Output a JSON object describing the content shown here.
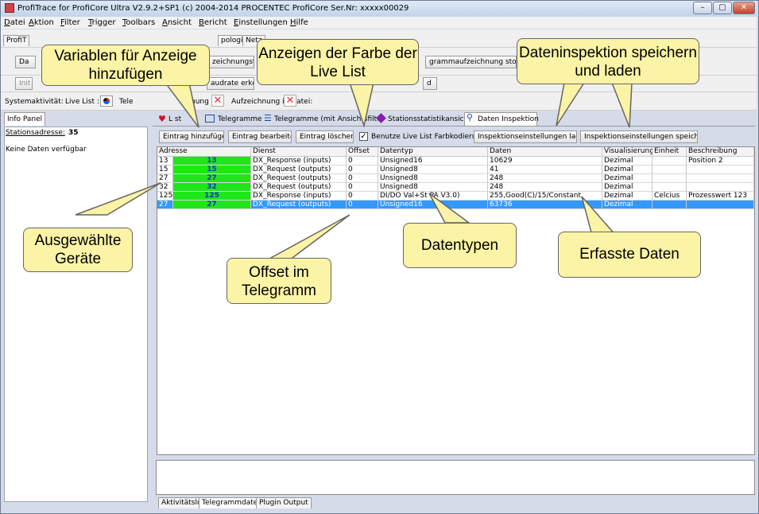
{
  "window": {
    "title": "ProfiTrace for ProfiCore Ultra V2.9.2+SP1 (c) 2004-2014 PROCENTEC  ProfiCore Ser.Nr: xxxxx00029",
    "controls": {
      "minimize": "–",
      "maximize": "▢",
      "close": "✕"
    }
  },
  "menu": [
    "Datei",
    "Aktion",
    "Filter",
    "Trigger",
    "Toolbars",
    "Ansicht",
    "Bericht",
    "Einstellungen",
    "Hilfe"
  ],
  "toolbar": {
    "tabs_partial": [
      "ProfiT",
      "pologie",
      "Netz"
    ],
    "row2_buttons": [
      "Da",
      "zeichnungstrig",
      "grammaufzeichnung stoppen"
    ],
    "row3_buttons": [
      "Init",
      "audrate erkenn",
      "d"
    ]
  },
  "status": {
    "system_label": "Systemaktivität:",
    "livelist_label": "Live List :",
    "tele_label": "Tele",
    "nung_label": "nung :",
    "recording_label": "Aufzeichnung in Datei:"
  },
  "info_panel": {
    "tab": "Info Panel",
    "station_label": "Stationsadresse:",
    "station_value": "35",
    "no_data": "Keine Daten verfügbar"
  },
  "main_tabs": [
    {
      "label": "L  st",
      "icon": "heart-icon"
    },
    {
      "label": "Telegramme",
      "icon": "telegram-icon"
    },
    {
      "label": "Telegramme (mit Ansichtsfilte",
      "icon": "filter-icon"
    },
    {
      "label": "Stationsstatistikansicht",
      "icon": "statistics-icon"
    },
    {
      "label": "Daten Inspektion",
      "icon": "magnifier-icon",
      "active": true
    }
  ],
  "actions": {
    "add": "Eintrag hinzufügen",
    "edit": "Eintrag bearbeiten",
    "delete": "Eintrag löschen",
    "use_colors": "Benutze Live List Farbkodierung",
    "load": "Inspektionseinstellungen laden",
    "save": "Inspektionseinstellungen speichern"
  },
  "table": {
    "headers": [
      "Adresse",
      "Dienst",
      "Offset",
      "Datentyp",
      "Daten",
      "Visualisierung",
      "Einheit",
      "Beschreibung"
    ],
    "rows": [
      {
        "addr": "13",
        "color": "13",
        "service": "DX_Response (inputs)",
        "offset": "0",
        "type": "Unsigned16",
        "data": "10629",
        "vis": "Dezimal",
        "unit": "",
        "desc": "Position 2"
      },
      {
        "addr": "15",
        "color": "15",
        "service": "DX_Request (outputs)",
        "offset": "0",
        "type": "Unsigned8",
        "data": "41",
        "vis": "Dezimal",
        "unit": "",
        "desc": ""
      },
      {
        "addr": "27",
        "color": "27",
        "service": "DX_Request (outputs)",
        "offset": "0",
        "type": "Unsigned8",
        "data": "248",
        "vis": "Dezimal",
        "unit": "",
        "desc": ""
      },
      {
        "addr": "32",
        "color": "32",
        "service": "DX_Request (outputs)",
        "offset": "0",
        "type": "Unsigned8",
        "data": "248",
        "vis": "Dezimal",
        "unit": "",
        "desc": ""
      },
      {
        "addr": "125",
        "color": "125",
        "service": "DX_Response (inputs)",
        "offset": "0",
        "type": "DI/DO Val+St      PA V3.0)",
        "data": "255,Good(C)/15/Constant",
        "vis": "Dezimal",
        "unit": "Celcius",
        "desc": "Prozesswert 123"
      },
      {
        "addr": "27",
        "color": "27",
        "service": "DX_Request (outputs)",
        "offset": "0",
        "type": "Unsigned16",
        "data": "63736",
        "vis": "Dezimal",
        "unit": "",
        "desc": "",
        "selected": true
      }
    ]
  },
  "bottom_tabs": [
    "Aktivitätslog",
    "Telegrammdaten",
    "Plugin Output"
  ],
  "callouts": {
    "variablen": "Variablen für Anzeige hinzufügen",
    "farbe": "Anzeigen der Farbe der Live List",
    "inspektion": "Dateninspektion speichern und laden",
    "geraete": "Ausgewählte Geräte",
    "offset": "Offset im Telegramm",
    "datentypen": "Datentypen",
    "daten": "Erfasste Daten"
  },
  "colors": {
    "live_list_green": "#1ee619",
    "selection_blue": "#3399ff",
    "callout_fill": "#fbf3a5"
  }
}
